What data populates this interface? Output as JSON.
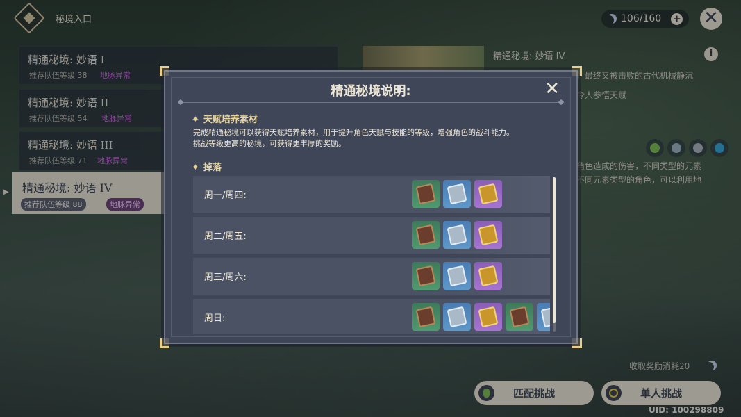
{
  "header": {
    "title": "秘境入口",
    "resin": "106/160"
  },
  "domains": [
    {
      "name": "精通秘境: 妙语 I",
      "level": "推荐队伍等级 38",
      "tag": "地脉异常"
    },
    {
      "name": "精通秘境: 妙语 II",
      "level": "推荐队伍等级 54",
      "tag": "地脉异常"
    },
    {
      "name": "精通秘境: 妙语 III",
      "level": "推荐队伍等级 71",
      "tag": "地脉异常"
    },
    {
      "name": "精通秘境: 妙语 IV",
      "level": "推荐队伍等级 88",
      "tag": "地脉异常"
    }
  ],
  "detail": {
    "title": "精通秘境: 妙语 IV",
    "desc_line1": "数百年前曾经占据于此，最终又被击败的古代机械静沉",
    "desc_line2": "魔物的话，或许能获得令人参悟天赋",
    "desc_line3": "角色造成的伤害，不同类型的元素",
    "desc_line4": "不同元素类型的角色，可以利用地",
    "reward_cost": "收取奖励消耗20",
    "match_button": "匹配挑战",
    "solo_button": "单人挑战",
    "uid": "UID: 100298809"
  },
  "modal": {
    "title": "精通秘境说明:",
    "section1_title": "天赋培养素材",
    "section1_line1": "完成精通秘境可以获得天赋培养素材，用于提升角色天赋与技能的等级，增强角色的战斗能力。",
    "section1_line2": "挑战等级更高的秘境，可获得更丰厚的奖励。",
    "section2_title": "掉落",
    "rows": [
      {
        "day": "周一/周四:"
      },
      {
        "day": "周二/周五:"
      },
      {
        "day": "周三/周六:"
      },
      {
        "day": "周日:"
      }
    ]
  },
  "colors": {
    "accent_gold": "#e8cf8e",
    "anomaly_purple": "#c56bd6",
    "panel": "#3f4658"
  }
}
